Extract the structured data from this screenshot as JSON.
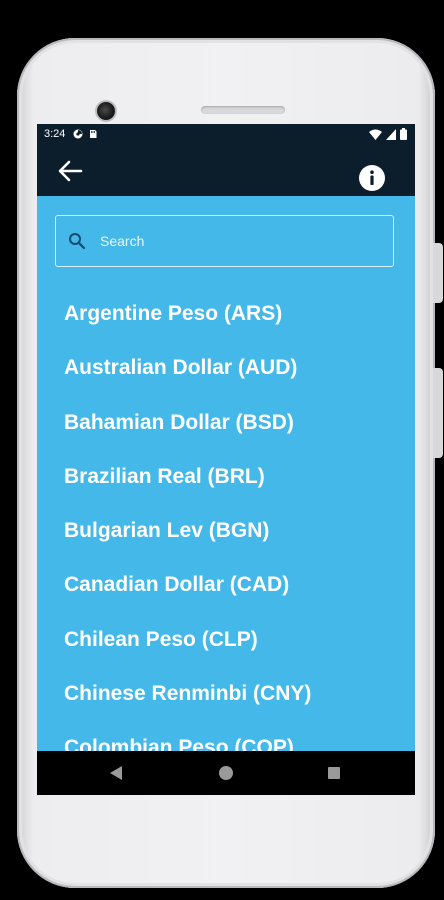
{
  "status_bar": {
    "time": "3:24",
    "left_icons": [
      "app-notification-icon",
      "sd-card-icon"
    ],
    "right_icons": [
      "wifi-icon",
      "signal-icon",
      "battery-icon"
    ]
  },
  "app_bar": {
    "background_color": "#0c1d2b",
    "back_icon": "arrow-left-icon",
    "info_icon": "info-icon"
  },
  "search": {
    "placeholder": "Search",
    "value": ""
  },
  "currencies": [
    "Argentine Peso (ARS)",
    "Australian Dollar (AUD)",
    "Bahamian Dollar (BSD)",
    "Brazilian Real (BRL)",
    "Bulgarian Lev (BGN)",
    "Canadian Dollar (CAD)",
    "Chilean Peso (CLP)",
    "Chinese Renminbi (CNY)",
    "Colombian Peso (COP)"
  ],
  "colors": {
    "screen_background": "#43b8e9",
    "text": "#ffffff",
    "bars": "#0c1d2b"
  },
  "nav_bar": {
    "buttons": [
      "nav-back-icon",
      "nav-home-icon",
      "nav-recents-icon"
    ]
  }
}
